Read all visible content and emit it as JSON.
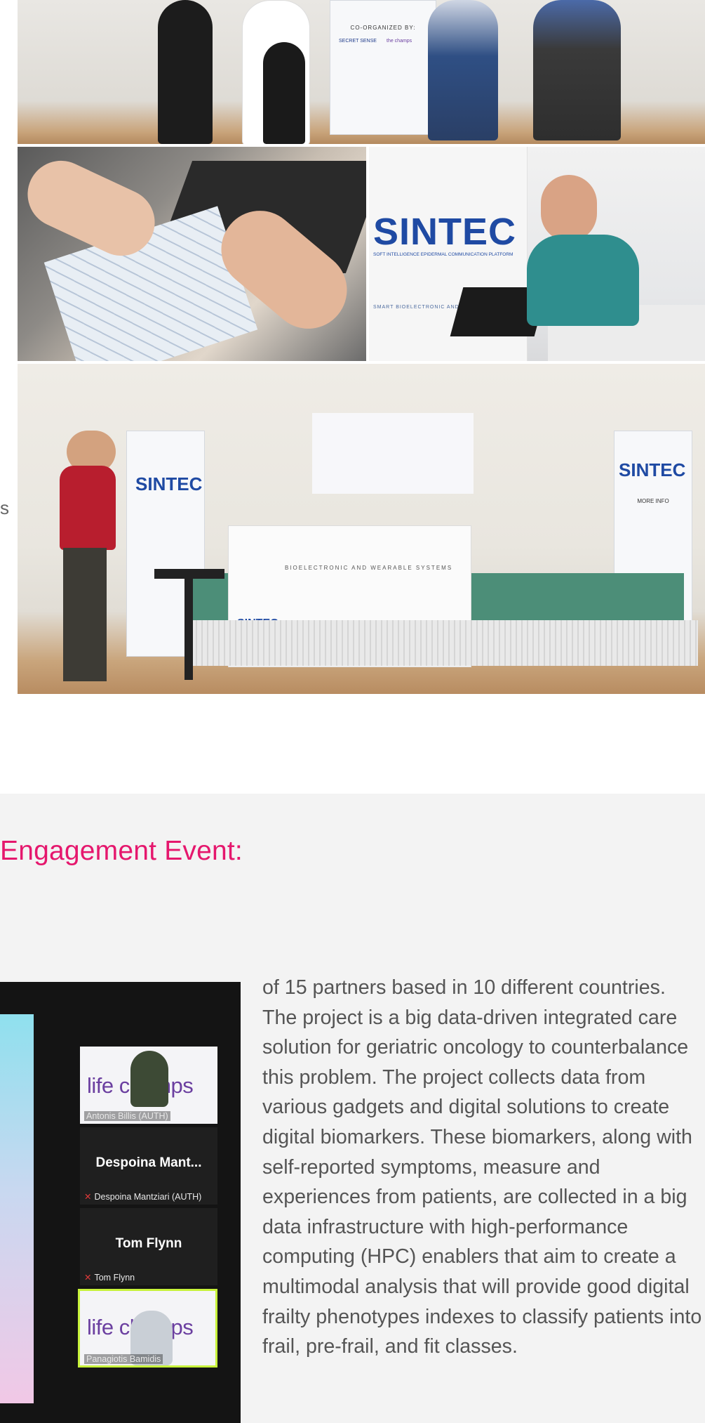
{
  "gallery": {
    "top_rollup_lines": [
      "CO-ORGANIZED BY:",
      "SECRET SENSE",
      "the champs"
    ],
    "speaker_banner_brand": "SINTEC",
    "speaker_banner_tagline": "SOFT INTELLIGENCE EPIDERMAL COMMUNICATION PLATFORM",
    "speaker_banner_subline": "SMART BIOELECTRONIC AND WE",
    "room_left_banner": "SINTEC",
    "room_right_banner": "SINTEC",
    "room_right_banner_info": "MORE INFO",
    "room_table_cloth_title": "BIOELECTRONIC AND WEARABLE SYSTEMS",
    "room_table_cloth_brand": "SINTEC"
  },
  "side_fragment": "s",
  "section": {
    "heading": "Engagement Event:",
    "body": "of 15 partners based in 10 different countries. The project is a big data-driven integrated care solution for geriatric oncology to counterbalance this problem. The project collects data from various gadgets and digital solutions to create digital biomarkers. These biomarkers, along with self-reported symptoms, measure and experiences from patients, are collected in a big data infrastructure with high-performance computing (HPC) enablers that aim to create a multimodal analysis that will provide good digital frailty phenotypes indexes to classify patients into frail, pre-frail, and fit classes."
  },
  "video_call": {
    "participants": [
      {
        "display": "life champs",
        "name": "Antonis Billis (AUTH)"
      },
      {
        "display": "Despoina Mant...",
        "name": "Despoina Mantziari (AUTH)"
      },
      {
        "display": "Tom Flynn",
        "name": "Tom Flynn"
      },
      {
        "display": "life champs",
        "name": "Panagiotis Bamidis"
      }
    ],
    "active_speaker_color": "#c7f23a"
  },
  "colors": {
    "heading": "#e5176d",
    "section_bg": "#f3f3f3",
    "text": "#555555"
  }
}
